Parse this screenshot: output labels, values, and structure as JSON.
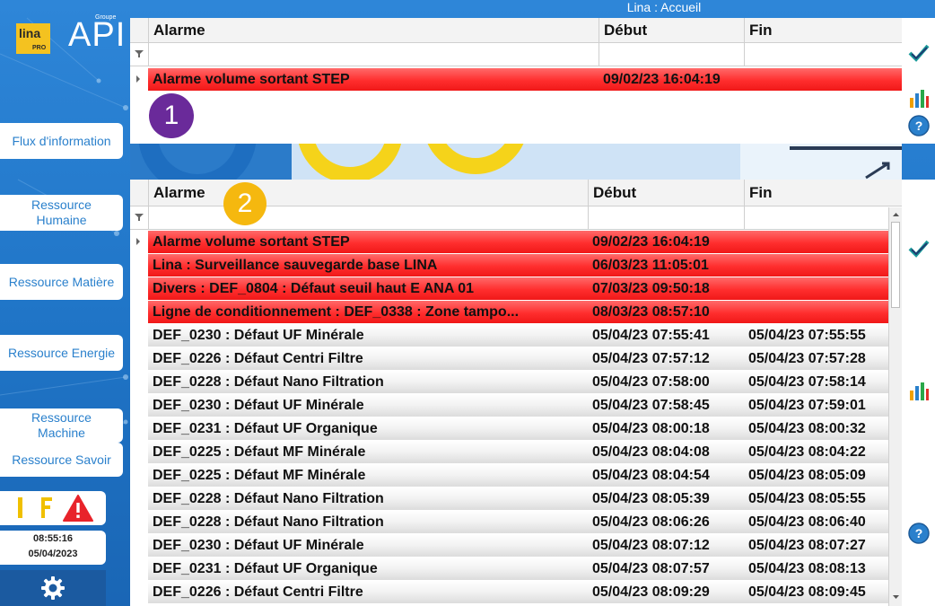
{
  "window": {
    "title": "Lina : Accueil"
  },
  "logo": {
    "lina": "lina",
    "pro": "PRO",
    "api": "API",
    "groupe": "Groupe"
  },
  "sidebar": {
    "items": [
      {
        "label": "Flux d'information"
      },
      {
        "label": "Ressource\nHumaine"
      },
      {
        "label": "Ressource Matière"
      },
      {
        "label": "Ressource Energie"
      },
      {
        "label": "Ressource\nMachine"
      },
      {
        "label": "Ressource Savoir"
      }
    ]
  },
  "status": {
    "clock_time": "08:55:16",
    "clock_date": "05/04/2023"
  },
  "colors": {
    "alarm_red": "#f01818",
    "header_bg": "#f3f3f3",
    "sidebar_blue": "#2a80cc",
    "badge1": "#6a2a9a",
    "badge2": "#f5b80f"
  },
  "table1": {
    "badge": "1",
    "columns": [
      "Alarme",
      "Début",
      "Fin"
    ],
    "rows": [
      {
        "alarme": "Alarme volume sortant STEP",
        "debut": "09/02/23 16:04:19",
        "fin": "",
        "state": "red"
      }
    ]
  },
  "table2": {
    "badge": "2",
    "columns": [
      "Alarme",
      "Début",
      "Fin"
    ],
    "rows": [
      {
        "alarme": "Alarme volume sortant STEP",
        "debut": "09/02/23 16:04:19",
        "fin": "",
        "state": "red"
      },
      {
        "alarme": "Lina : Surveillance sauvegarde base LINA",
        "debut": "06/03/23 11:05:01",
        "fin": "",
        "state": "red"
      },
      {
        "alarme": "Divers : DEF_0804 : Défaut seuil haut E ANA 01",
        "debut": "07/03/23 09:50:18",
        "fin": "",
        "state": "red"
      },
      {
        "alarme": "Ligne de conditionnement : DEF_0338 : Zone tampo...",
        "debut": "08/03/23 08:57:10",
        "fin": "",
        "state": "red"
      },
      {
        "alarme": "DEF_0230 : Défaut UF Minérale",
        "debut": "05/04/23 07:55:41",
        "fin": "05/04/23 07:55:55",
        "state": "grey"
      },
      {
        "alarme": "DEF_0226 : Défaut Centri Filtre",
        "debut": "05/04/23 07:57:12",
        "fin": "05/04/23 07:57:28",
        "state": "grey"
      },
      {
        "alarme": "DEF_0228 : Défaut Nano Filtration",
        "debut": "05/04/23 07:58:00",
        "fin": "05/04/23 07:58:14",
        "state": "grey"
      },
      {
        "alarme": "DEF_0230 : Défaut UF Minérale",
        "debut": "05/04/23 07:58:45",
        "fin": "05/04/23 07:59:01",
        "state": "grey"
      },
      {
        "alarme": "DEF_0231 : Défaut UF Organique",
        "debut": "05/04/23 08:00:18",
        "fin": "05/04/23 08:00:32",
        "state": "grey"
      },
      {
        "alarme": "DEF_0225 : Défaut MF Minérale",
        "debut": "05/04/23 08:04:08",
        "fin": "05/04/23 08:04:22",
        "state": "grey"
      },
      {
        "alarme": "DEF_0225 : Défaut MF Minérale",
        "debut": "05/04/23 08:04:54",
        "fin": "05/04/23 08:05:09",
        "state": "grey"
      },
      {
        "alarme": "DEF_0228 : Défaut Nano Filtration",
        "debut": "05/04/23 08:05:39",
        "fin": "05/04/23 08:05:55",
        "state": "grey"
      },
      {
        "alarme": "DEF_0228 : Défaut Nano Filtration",
        "debut": "05/04/23 08:06:26",
        "fin": "05/04/23 08:06:40",
        "state": "grey"
      },
      {
        "alarme": "DEF_0230 : Défaut UF Minérale",
        "debut": "05/04/23 08:07:12",
        "fin": "05/04/23 08:07:27",
        "state": "grey"
      },
      {
        "alarme": "DEF_0231 : Défaut UF Organique",
        "debut": "05/04/23 08:07:57",
        "fin": "05/04/23 08:08:13",
        "state": "grey"
      },
      {
        "alarme": "DEF_0226 : Défaut Centri Filtre",
        "debut": "05/04/23 08:09:29",
        "fin": "05/04/23 08:09:45",
        "state": "grey"
      }
    ]
  },
  "icons": {
    "toolbar": [
      "check-icon",
      "bar-chart-icon",
      "help-icon"
    ],
    "filter": "filter-icon",
    "status": [
      "warning-icon",
      "gear-icon"
    ]
  }
}
